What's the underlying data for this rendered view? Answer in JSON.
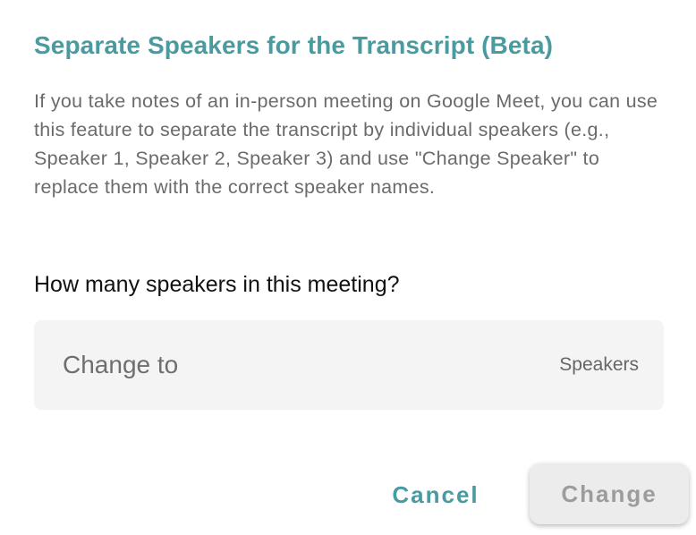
{
  "dialog": {
    "title": "Separate Speakers for the Transcript (Beta)",
    "description": "If you take notes of an in-person meeting on Google Meet, you can use this feature to separate the transcript by individual speakers (e.g., Speaker 1, Speaker 2, Speaker 3) and use \"Change Speaker\" to replace them with the correct speaker names.",
    "question": "How many speakers in this meeting?",
    "input": {
      "value": "",
      "placeholder": "Change to",
      "suffix": "Speakers"
    },
    "buttons": {
      "cancel_label": "Cancel",
      "change_label": "Change",
      "change_disabled": true
    }
  },
  "colors": {
    "accent": "#4a9ba0",
    "input_background": "#f4f4f4",
    "disabled_button_background": "#ececec",
    "disabled_button_text": "#9c9c9c"
  }
}
